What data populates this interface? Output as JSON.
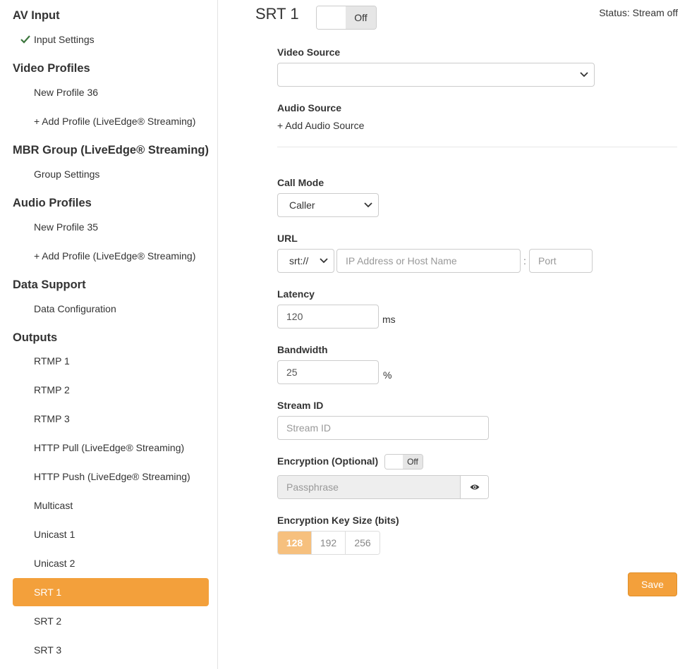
{
  "sidebar": {
    "sections": [
      {
        "title": "AV Input"
      },
      {
        "title": "Video Profiles"
      },
      {
        "title": "MBR Group (LiveEdge® Streaming)"
      },
      {
        "title": "Audio Profiles"
      },
      {
        "title": "Data Support"
      },
      {
        "title": "Outputs"
      }
    ],
    "items": {
      "input_settings": "Input Settings",
      "video_profile": "New Profile 36",
      "add_video_profile": "+ Add Profile (LiveEdge® Streaming)",
      "group_settings": "Group Settings",
      "audio_profile": "New Profile 35",
      "add_audio_profile": "+ Add Profile (LiveEdge® Streaming)",
      "data_configuration": "Data Configuration",
      "outputs": [
        "RTMP 1",
        "RTMP 2",
        "RTMP 3",
        "HTTP Pull (LiveEdge® Streaming)",
        "HTTP Push (LiveEdge® Streaming)",
        "Multicast",
        "Unicast 1",
        "Unicast 2",
        "SRT 1",
        "SRT 2",
        "SRT 3"
      ],
      "active_output": "SRT 1"
    }
  },
  "main": {
    "title": "SRT 1",
    "toggle_label": "Off",
    "status": "Status: Stream off",
    "video_source_label": "Video Source",
    "video_source_value": "",
    "audio_source_label": "Audio Source",
    "add_audio_source": "+ Add Audio Source",
    "call_mode_label": "Call Mode",
    "call_mode_value": "Caller",
    "url_label": "URL",
    "url_scheme": "srt://",
    "url_host_placeholder": "IP Address or Host Name",
    "url_separator": ":",
    "url_port_placeholder": "Port",
    "latency_label": "Latency",
    "latency_value": "120",
    "latency_unit": "ms",
    "bandwidth_label": "Bandwidth",
    "bandwidth_value": "25",
    "bandwidth_unit": "%",
    "stream_id_label": "Stream ID",
    "stream_id_placeholder": "Stream ID",
    "encryption_label": "Encryption (Optional)",
    "encryption_toggle": "Off",
    "passphrase_placeholder": "Passphrase",
    "key_size_label": "Encryption Key Size (bits)",
    "key_sizes": [
      "128",
      "192",
      "256"
    ],
    "key_size_selected": "128",
    "save_label": "Save"
  },
  "colors": {
    "accent": "#f3a03b",
    "selected_key": "#f6c07e",
    "check": "#3c763d"
  }
}
